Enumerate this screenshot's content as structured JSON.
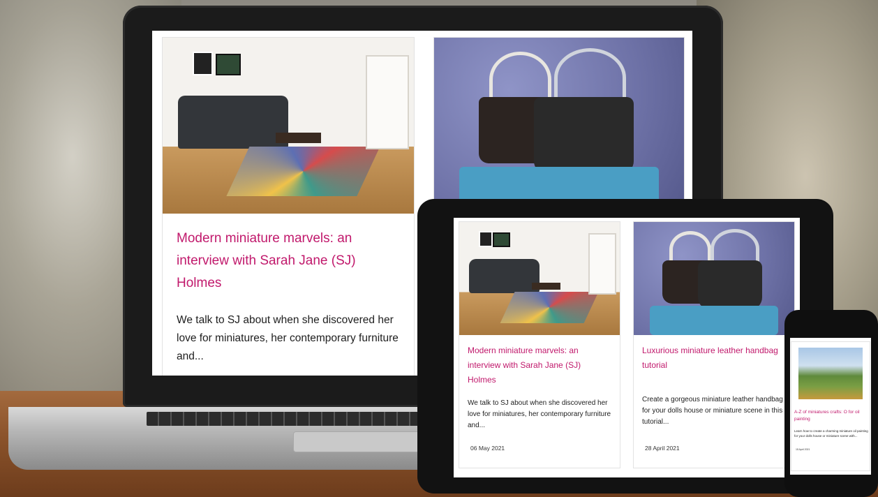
{
  "laptop": {
    "card1": {
      "title": "Modern miniature marvels: an interview with Sarah Jane (SJ) Holmes",
      "excerpt": "We talk to SJ about when she discovered her love for miniatures, her contemporary furniture and..."
    }
  },
  "tablet": {
    "card1": {
      "title": "Modern miniature marvels: an interview with Sarah Jane (SJ) Holmes",
      "excerpt": "We talk to SJ about when she discovered her love for miniatures, her contemporary furniture and...",
      "date": "06 May 2021"
    },
    "card2": {
      "title": "Luxurious miniature leather handbag tutorial",
      "excerpt": "Create a gorgeous miniature leather handbag for your dolls house or miniature scene in this tutorial...",
      "date": "28 April 2021"
    }
  },
  "phone": {
    "card1": {
      "title": "A-Z of miniatures crafts: O for oil painting",
      "excerpt": "Learn how to create a charming miniature oil painting for your dolls house or miniature scene with...",
      "date": "15 April 2021"
    }
  },
  "colors": {
    "title_accent": "#c1196c"
  }
}
